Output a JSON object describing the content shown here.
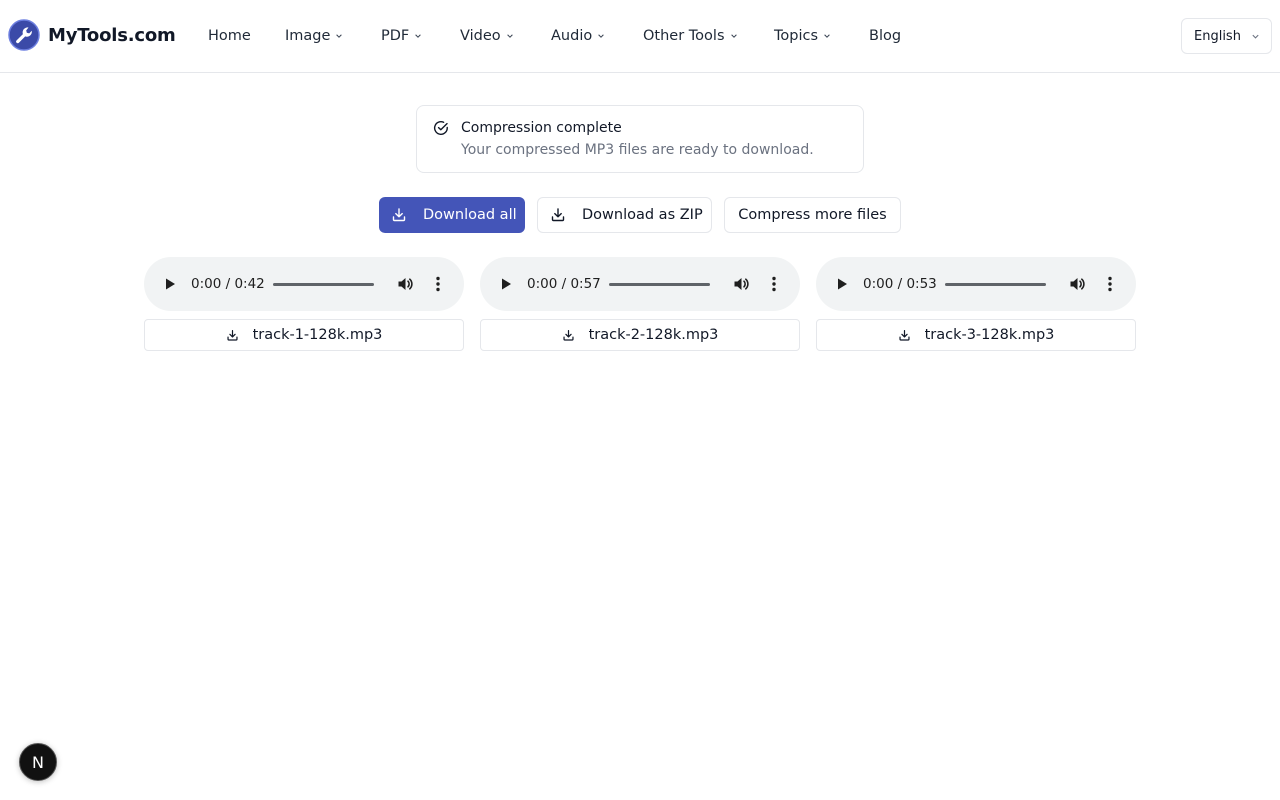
{
  "header": {
    "brand": "MyTools.com",
    "nav": [
      {
        "label": "Home",
        "dropdown": false
      },
      {
        "label": "Image",
        "dropdown": true
      },
      {
        "label": "PDF",
        "dropdown": true
      },
      {
        "label": "Video",
        "dropdown": true
      },
      {
        "label": "Audio",
        "dropdown": true
      },
      {
        "label": "Other Tools",
        "dropdown": true
      },
      {
        "label": "Topics",
        "dropdown": true
      },
      {
        "label": "Blog",
        "dropdown": false
      }
    ],
    "language": "English"
  },
  "alert": {
    "title": "Compression complete",
    "description": "Your compressed MP3 files are ready to download."
  },
  "actions": {
    "download_all": "Download all",
    "download_zip": "Download as ZIP",
    "compress_more": "Compress more files"
  },
  "tracks": [
    {
      "time": "0:00 / 0:42",
      "filename": "track-1-128k.mp3"
    },
    {
      "time": "0:00 / 0:57",
      "filename": "track-2-128k.mp3"
    },
    {
      "time": "0:00 / 0:53",
      "filename": "track-3-128k.mp3"
    }
  ],
  "badge": {
    "letter": "N"
  },
  "colors": {
    "primary": "#4455b8",
    "border": "#e5e7eb",
    "muted_text": "#6b7280",
    "player_bg": "#f1f3f4"
  },
  "icons": {
    "logo": "wrench-logo-icon",
    "alert": "check-circle-icon",
    "download": "download-icon",
    "play": "play-icon",
    "volume": "volume-icon",
    "more": "more-vertical-icon",
    "chevron": "chevron-down-icon"
  }
}
